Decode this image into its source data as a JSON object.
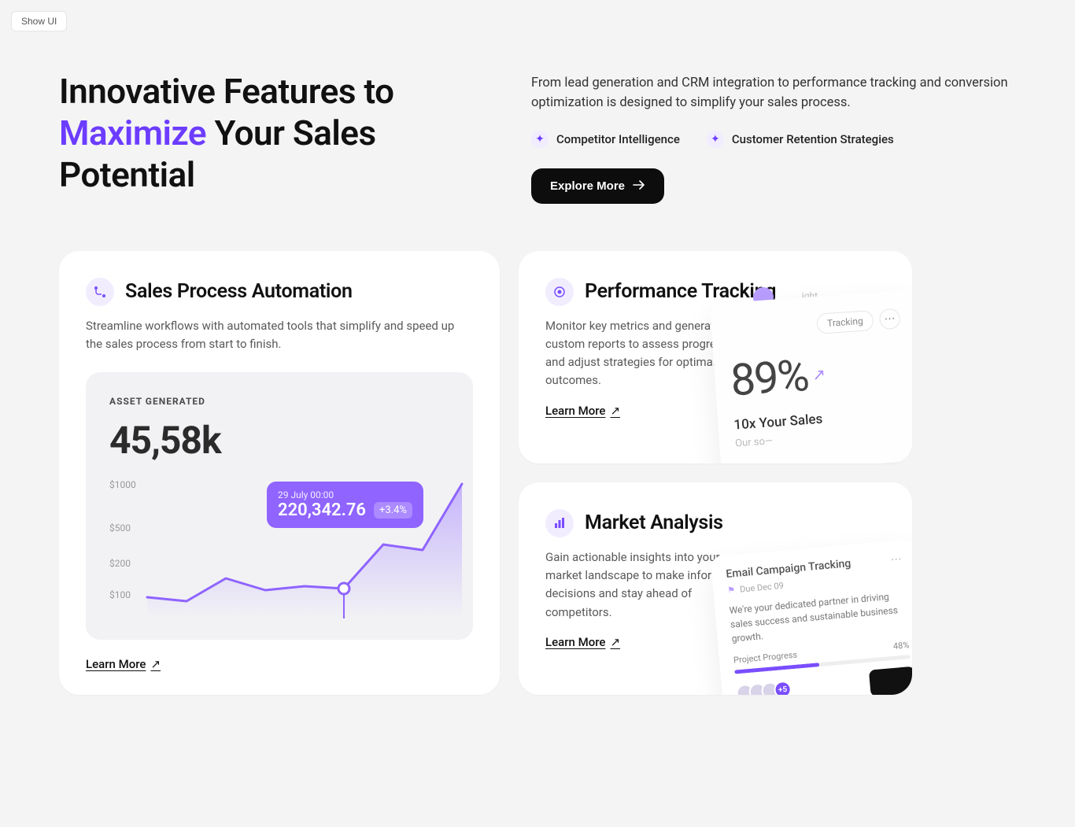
{
  "show_ui": "Show UI",
  "hero": {
    "title_prefix": "Innovative Features to",
    "title_accent": "Maximize",
    "title_suffix": " Your Sales Potential",
    "subtitle": "From lead generation and CRM integration to performance tracking and conversion optimization is designed to simplify your sales process.",
    "badges": [
      "Competitor Intelligence",
      "Customer Retention Strategies"
    ],
    "cta": "Explore More"
  },
  "cards": {
    "sales": {
      "title": "Sales Process Automation",
      "desc": "Streamline workflows with automated tools that simplify and speed up the sales process from start to finish.",
      "learn": "Learn More",
      "widget": {
        "label": "ASSET GENERATED",
        "value": "45,58k",
        "yticks": [
          "$1000",
          "$500",
          "$200",
          "$100"
        ],
        "tooltip_date": "29 July 00:00",
        "tooltip_value": "220,342.76",
        "tooltip_change": "+3.4%"
      }
    },
    "perf": {
      "title": "Performance Tracking",
      "desc": "Monitor key metrics and generate custom reports to assess progress and adjust strategies for optimal outcomes.",
      "learn": "Learn More",
      "pill": "Tracking",
      "pct": "89%",
      "subline": "10x Your Sales",
      "fade": "Our so—",
      "insight": "ight"
    },
    "market": {
      "title": "Market Analysis",
      "desc": "Gain actionable insights into your market landscape to make informed decisions and stay ahead of competitors.",
      "learn": "Learn More",
      "track": {
        "title": "Email Campaign Tracking",
        "due": "Due Dec 09",
        "body": "We're your dedicated partner in driving sales success and sustainable business growth.",
        "progress_label": "Project Progress",
        "progress_pct": "48%",
        "plus": "+5"
      }
    }
  },
  "chart_data": {
    "type": "line",
    "widget_title": "ASSET GENERATED",
    "headline_value": "45,58k",
    "ylabel": "",
    "yticks": [
      1000,
      500,
      200,
      100
    ],
    "ytick_labels": [
      "$1000",
      "$500",
      "$200",
      "$100"
    ],
    "x": [
      0,
      1,
      2,
      3,
      4,
      5,
      6,
      7,
      8
    ],
    "values": [
      150,
      120,
      280,
      200,
      230,
      210,
      520,
      480,
      950
    ],
    "highlight": {
      "x_index": 5,
      "date_label": "29 July 00:00",
      "value": 220342.76,
      "value_label": "220,342.76",
      "change": 3.4,
      "change_label": "+3.4%"
    },
    "ylim": [
      0,
      1000
    ]
  }
}
